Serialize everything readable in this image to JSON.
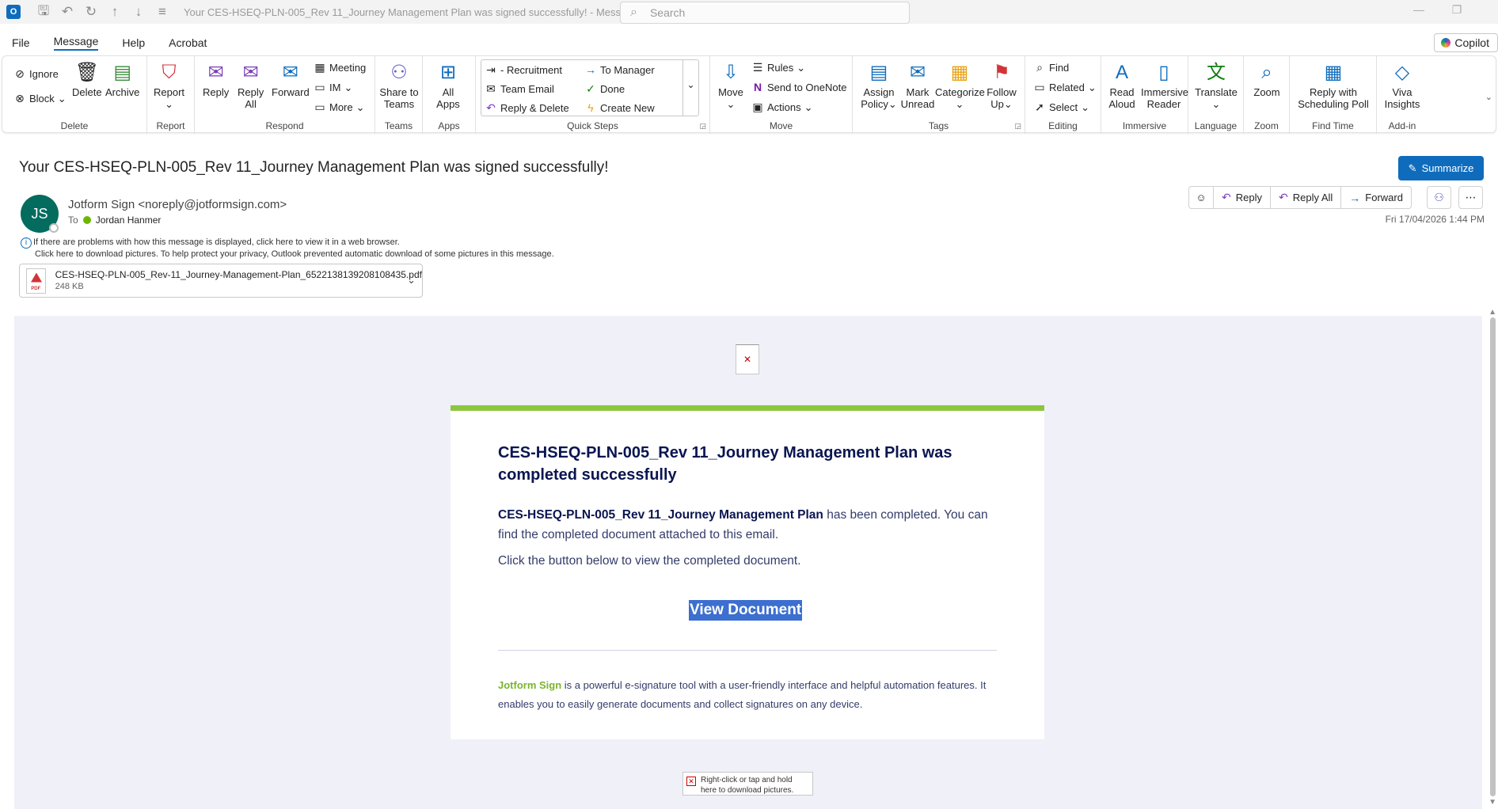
{
  "titlebar": {
    "app_icon": "O",
    "title": "Your CES-HSEQ-PLN-005_Rev 11_Journey Management Plan was signed successfully!  -  Message (HT...",
    "search_placeholder": "Search"
  },
  "menu": {
    "items": [
      "File",
      "Message",
      "Help",
      "Acrobat"
    ],
    "active": "Message",
    "copilot": "Copilot"
  },
  "ribbon": {
    "delete_group": {
      "label": "Delete",
      "ignore": "Ignore",
      "block": "Block",
      "delete": "Delete",
      "archive": "Archive"
    },
    "report_group": {
      "label": "Report",
      "report": "Report"
    },
    "respond_group": {
      "label": "Respond",
      "reply": "Reply",
      "reply_all_1": "Reply",
      "reply_all_2": "All",
      "forward": "Forward",
      "meeting": "Meeting",
      "im": "IM",
      "more": "More"
    },
    "teams_group": {
      "label": "Teams",
      "share_1": "Share to",
      "share_2": "Teams"
    },
    "apps_group": {
      "label": "Apps",
      "all_1": "All",
      "all_2": "Apps"
    },
    "quick_steps": {
      "label": "Quick Steps",
      "items": [
        "- Recruitment",
        "To Manager",
        "Team Email",
        "Done",
        "Reply & Delete",
        "Create New"
      ]
    },
    "move_group": {
      "label": "Move",
      "move": "Move",
      "rules": "Rules",
      "onenote": "Send to OneNote",
      "actions": "Actions"
    },
    "tags_group": {
      "label": "Tags",
      "assign_1": "Assign",
      "assign_2": "Policy",
      "mark_1": "Mark",
      "mark_2": "Unread",
      "categorize": "Categorize",
      "follow_1": "Follow",
      "follow_2": "Up"
    },
    "editing_group": {
      "label": "Editing",
      "find": "Find",
      "related": "Related",
      "select": "Select"
    },
    "immersive_group": {
      "label": "Immersive",
      "read_1": "Read",
      "read_2": "Aloud",
      "imm_1": "Immersive",
      "imm_2": "Reader"
    },
    "language_group": {
      "label": "Language",
      "translate": "Translate"
    },
    "zoom_group": {
      "label": "Zoom",
      "zoom": "Zoom"
    },
    "findtime_group": {
      "label": "Find Time",
      "poll_1": "Reply with",
      "poll_2": "Scheduling Poll"
    },
    "addin_group": {
      "label": "Add-in",
      "viva_1": "Viva",
      "viva_2": "Insights"
    }
  },
  "message": {
    "subject": "Your CES-HSEQ-PLN-005_Rev 11_Journey Management Plan was signed successfully!",
    "summarize": "Summarize",
    "avatar_initials": "JS",
    "sender": "Jotform Sign <noreply@jotformsign.com>",
    "to_label": "To",
    "recipient": "Jordan Hanmer",
    "info_line_1": "If there are problems with how this message is displayed, click here to view it in a web browser.",
    "info_line_2": "Click here to download pictures. To help protect your privacy, Outlook prevented automatic download of some pictures in this message.",
    "actions": {
      "reply": "Reply",
      "reply_all": "Reply All",
      "forward": "Forward"
    },
    "date": "Fri 17/04/2026 1:44 PM",
    "attachment": {
      "name": "CES-HSEQ-PLN-005_Rev-11_Journey-Management-Plan_6522138139208108435.pdf",
      "size": "248 KB"
    }
  },
  "email_body": {
    "title": "CES-HSEQ-PLN-005_Rev 11_Journey Management Plan was completed successfully",
    "p1_bold": "CES-HSEQ-PLN-005_Rev 11_Journey Management Plan",
    "p1_rest": " has been completed. You can find the completed document attached to this email.",
    "p2": "Click the button below to view the completed document.",
    "button": "View Document",
    "footer_brand": "Jotform Sign",
    "footer_text": " is a powerful e-signature tool with a user-friendly interface and helpful automation features. It enables you to easily generate documents and collect signatures on any device.",
    "bottom_image_text": "Right-click or tap and hold here to download pictures."
  },
  "colors": {
    "accent": "#0f6cbd",
    "card_top": "#8cc63f",
    "brand_green": "#78b52c",
    "title_navy": "#0a1551",
    "selection": "#3c6fcf",
    "avatar": "#036c5f"
  }
}
